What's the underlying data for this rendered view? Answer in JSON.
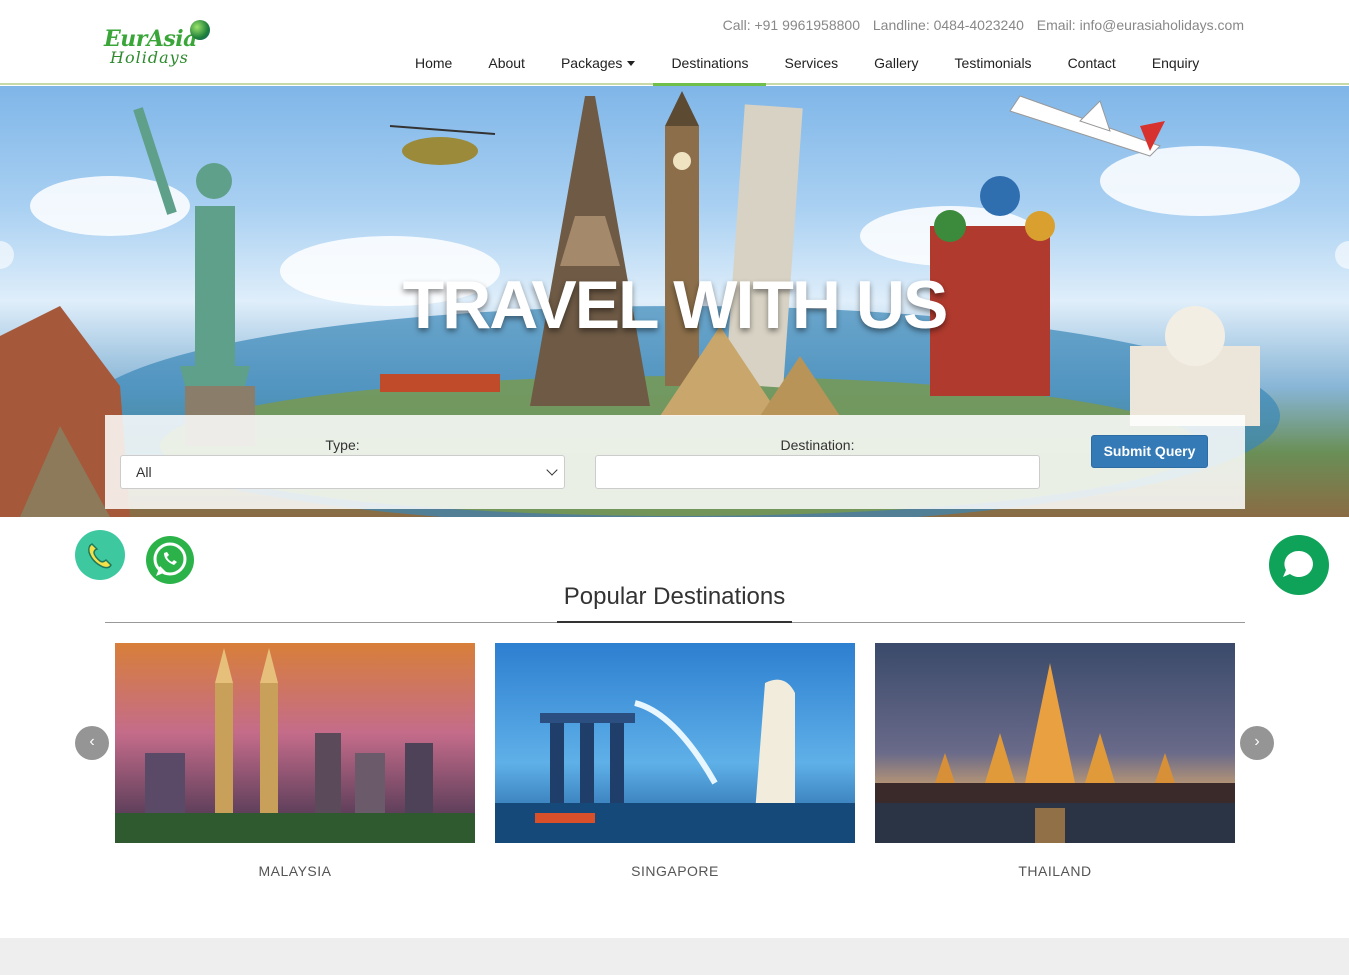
{
  "brand": {
    "logo_main": "EurAsia",
    "logo_sub": "Holidays"
  },
  "contact": {
    "call": "Call: +91 9961958800",
    "landline": "Landline: 0484-4023240",
    "email": "Email: info@eurasiaholidays.com"
  },
  "nav": {
    "items": [
      {
        "label": "Home"
      },
      {
        "label": "About"
      },
      {
        "label": "Packages"
      },
      {
        "label": "Destinations"
      },
      {
        "label": "Services"
      },
      {
        "label": "Gallery"
      },
      {
        "label": "Testimonials"
      },
      {
        "label": "Contact"
      },
      {
        "label": "Enquiry"
      }
    ],
    "active": "Destinations"
  },
  "hero": {
    "title": "TRAVEL WITH US"
  },
  "search": {
    "type_label": "Type:",
    "type_value": "All",
    "destination_label": "Destination:",
    "destination_value": "",
    "submit_label": "Submit Query"
  },
  "popular": {
    "title": "Popular Destinations",
    "destinations": [
      {
        "name": "MALAYSIA"
      },
      {
        "name": "SINGAPORE"
      },
      {
        "name": "THAILAND"
      }
    ],
    "prev_label": "‹",
    "next_label": "›"
  },
  "colors": {
    "accent": "#6fbf4a",
    "button": "#337ab7",
    "chat": "#0fa35a"
  }
}
